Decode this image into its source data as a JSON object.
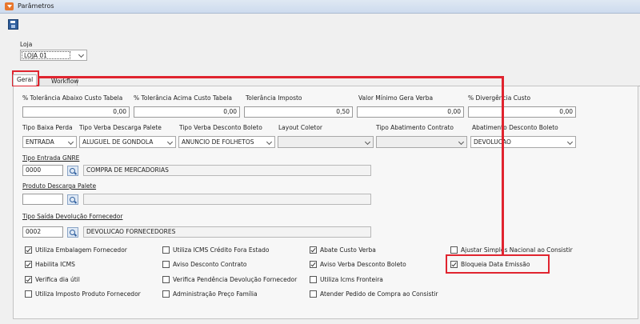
{
  "window": {
    "title": "Parâmetros"
  },
  "loja": {
    "label": "Loja",
    "value": "LOJA 01"
  },
  "tabs": [
    {
      "label": "Geral"
    },
    {
      "label": "Workflow"
    }
  ],
  "row1": {
    "labels": [
      "% Tolerância Abaixo Custo Tabela",
      "% Tolerância Acima Custo Tabela",
      "Tolerância Imposto",
      "Valor Mínimo Gera Verba",
      "% Divergência Custo"
    ],
    "values": [
      "0,00",
      "0,00",
      "0,50",
      "0,00",
      "0,00"
    ]
  },
  "row2": {
    "labels": [
      "Tipo Baixa Perda",
      "Tipo Verba Descarga Palete",
      "Tipo Verba Desconto Boleto",
      "Layout Coletor",
      "Tipo Abatimento Contrato",
      "Abatimento Desconto Boleto"
    ],
    "values": [
      "ENTRADA",
      "ALUGUEL DE GONDOLA",
      "ANUNCIO DE FOLHETOS",
      "",
      "",
      "DEVOLUCAO"
    ]
  },
  "gnre": {
    "label": "Tipo Entrada GNRE",
    "code": "0000",
    "desc": "COMPRA DE MERCADORIAS"
  },
  "palete": {
    "label": "Produto Descarga Palete",
    "code": "",
    "desc": ""
  },
  "devolucao": {
    "label": "Tipo Saída Devolução Fornecedor",
    "code": "0002",
    "desc": "DEVOLUCAO FORNECEDORES"
  },
  "checkboxes": {
    "col1": [
      {
        "label": "Utiliza Embalagem Fornecedor",
        "checked": true
      },
      {
        "label": "Habilita ICMS",
        "checked": true
      },
      {
        "label": "Verifica dia útil",
        "checked": true
      },
      {
        "label": "Utiliza Imposto Produto Fornecedor",
        "checked": false
      }
    ],
    "col2": [
      {
        "label": "Utiliza ICMS Crédito Fora Estado",
        "checked": false
      },
      {
        "label": "Aviso Desconto Contrato",
        "checked": false
      },
      {
        "label": "Verifica Pendência Devolução Fornecedor",
        "checked": false
      },
      {
        "label": "Administração Preço Família",
        "checked": false
      }
    ],
    "col3": [
      {
        "label": "Abate Custo Verba",
        "checked": true
      },
      {
        "label": "Aviso Verba Desconto Boleto",
        "checked": true
      },
      {
        "label": "Utiliza Icms Fronteira",
        "checked": false
      },
      {
        "label": "Atender Pedido de Compra ao Consistir",
        "checked": false
      }
    ],
    "col4": [
      {
        "label": "Ajustar Simples Nacional ao Consistir",
        "checked": false
      },
      {
        "label": "Bloqueia Data Emissão",
        "checked": true
      }
    ]
  },
  "colors": {
    "highlight": "#e0242f",
    "window_bg": "#f0f0f0",
    "title_icon": "#e8772e"
  },
  "icons": {
    "save": "save-icon",
    "lookup": "search-icon",
    "app": "app-menu-icon"
  }
}
